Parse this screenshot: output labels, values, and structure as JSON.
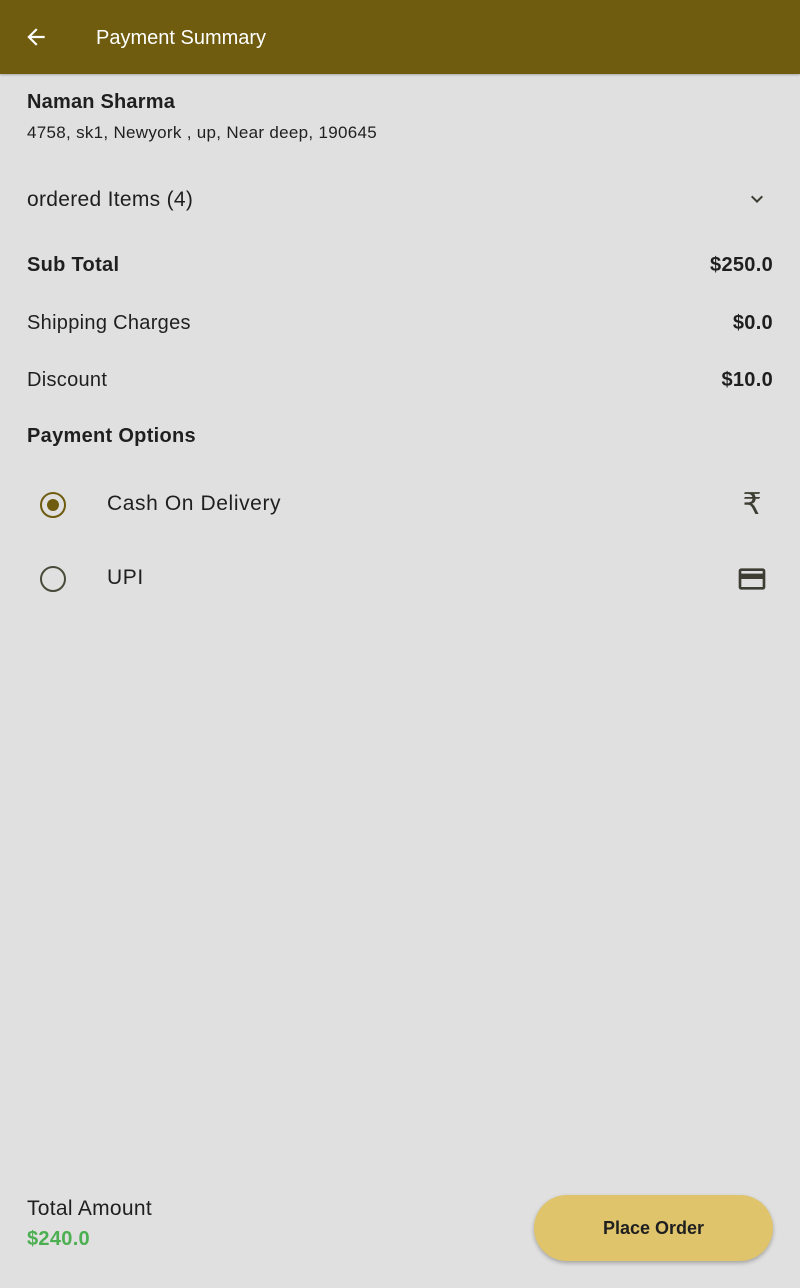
{
  "appbar": {
    "title": "Payment Summary",
    "back_icon": "arrow-left-icon",
    "color": "#6f5c0f"
  },
  "address": {
    "name": "Naman Sharma",
    "line": "4758, sk1, Newyork , up, Near deep, 190645"
  },
  "ordered_items": {
    "label": "ordered Items (4)",
    "expand_icon": "chevron-down-icon"
  },
  "summary": {
    "subtotal": {
      "label": "Sub Total",
      "value": "$250.0"
    },
    "shipping": {
      "label": "Shipping Charges",
      "value": "$0.0"
    },
    "discount": {
      "label": "Discount",
      "value": "$10.0"
    }
  },
  "payment": {
    "title": "Payment Options",
    "options": [
      {
        "label": "Cash On Delivery",
        "selected": true,
        "icon": "rupee-icon",
        "glyph": "₹"
      },
      {
        "label": "UPI",
        "selected": false,
        "icon": "credit-card-icon"
      }
    ]
  },
  "footer": {
    "total_label": "Total Amount",
    "total_value": "$240.0",
    "total_color": "#4caf50",
    "button_label": "Place Order",
    "button_color": "#dfc46c"
  }
}
